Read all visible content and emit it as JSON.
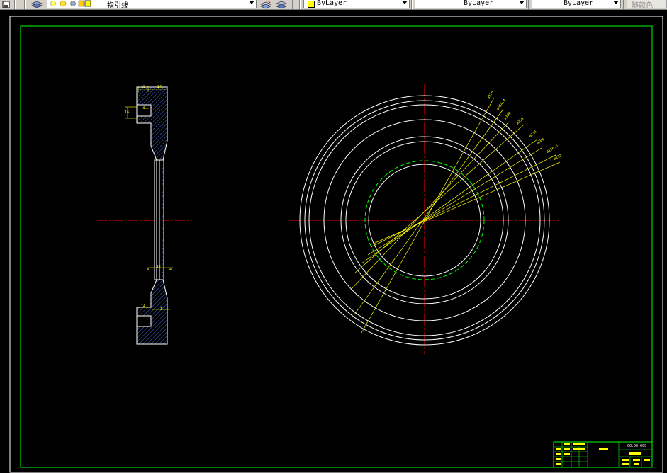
{
  "toolbar": {
    "layer_name": "指引线",
    "color": "ByLayer",
    "linetype": "ByLayer",
    "lineweight": "ByLayer",
    "plot_color": "随颜色"
  },
  "drawing": {
    "top_dims": [
      "18",
      "24"
    ],
    "left_dims": [
      "16",
      "6"
    ],
    "mid_dims": [
      "4",
      "12",
      "4"
    ],
    "bot_dims": [
      "14",
      "1"
    ],
    "diameter_labels": [
      "ø378",
      "ø354.4",
      "ø300",
      "ø250",
      "ø234",
      "ø180",
      "ø156.6",
      "ø132"
    ],
    "title_block": {
      "drawing_no": "00.00.000"
    }
  },
  "colors": {
    "background": "#000000",
    "border": "#00ff00",
    "outline": "#ffffff",
    "centerline": "#ff0000",
    "leader": "#ffff00",
    "hatch": "#4a6fd6",
    "hidden": "#00ff00"
  }
}
